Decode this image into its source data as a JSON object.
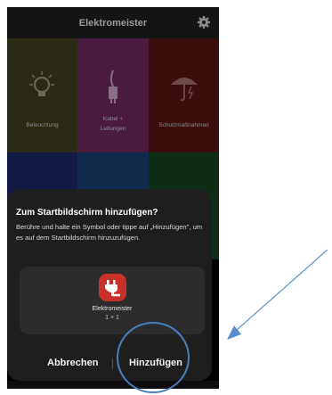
{
  "app_bar": {
    "title": "Elektromeister",
    "settings_icon": "gear-icon"
  },
  "tiles": [
    {
      "label": "Beleuchtung",
      "icon": "lightbulb-icon",
      "color": "#2b2a14"
    },
    {
      "label": "Kabel + Leitungen",
      "icon": "cable-plug-icon",
      "color": "#4a1a3f"
    },
    {
      "label": "Schutzmaßnahmen",
      "icon": "umbrella-lightning-icon",
      "color": "#3b0d0d"
    },
    {
      "label": "",
      "icon": "gear-icon",
      "color": "#121a44"
    },
    {
      "label": "",
      "icon": "circle-icon",
      "color": "#0f2a4a"
    },
    {
      "label": "",
      "icon": "plant-icon",
      "color": "#0e2d16"
    }
  ],
  "dialog": {
    "title": "Zum Startbildschirm hinzufügen?",
    "message": "Berühre und halte ein Symbol oder tippe auf „Hinzufügen\", um es auf dem Startbildschirm hinzuzufügen.",
    "shortcut": {
      "name": "Elektromeister",
      "size": "1 × 1",
      "icon": "plug-icon"
    },
    "cancel_label": "Abbrechen",
    "add_label": "Hinzufügen"
  },
  "annotation": {
    "color": "#4a7fc0"
  }
}
